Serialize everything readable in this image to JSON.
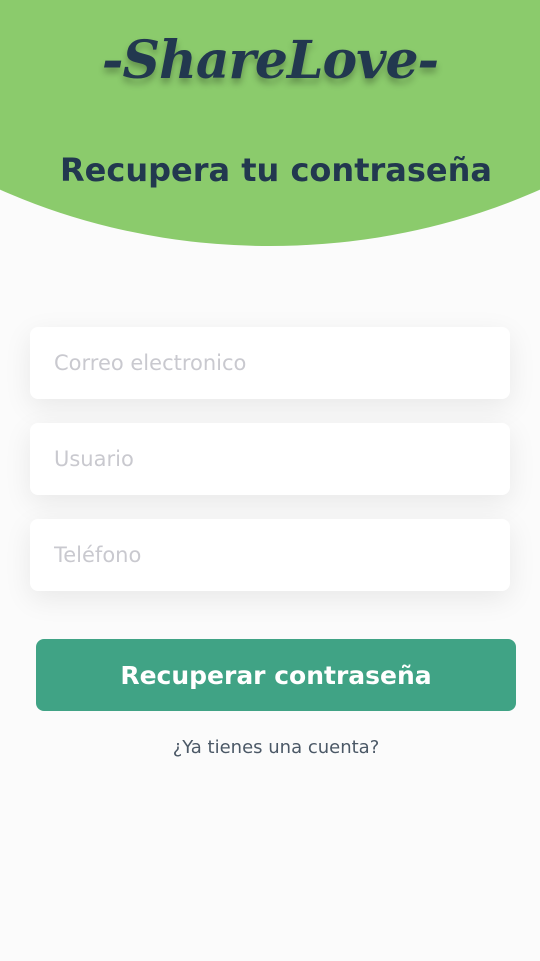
{
  "header": {
    "logo_text": "-ShareLove-",
    "title": "Recupera tu contraseña"
  },
  "form": {
    "email_placeholder": "Correo electronico",
    "email_value": "",
    "user_placeholder": "Usuario",
    "user_value": "",
    "phone_placeholder": "Teléfono",
    "phone_value": "",
    "submit_label": "Recuperar contraseña",
    "login_link": "¿Ya tienes una cuenta?"
  },
  "colors": {
    "header_green": "#8bcb6c",
    "primary_button": "#40a385",
    "title_navy": "#22384f",
    "background": "#fbfbfb"
  }
}
